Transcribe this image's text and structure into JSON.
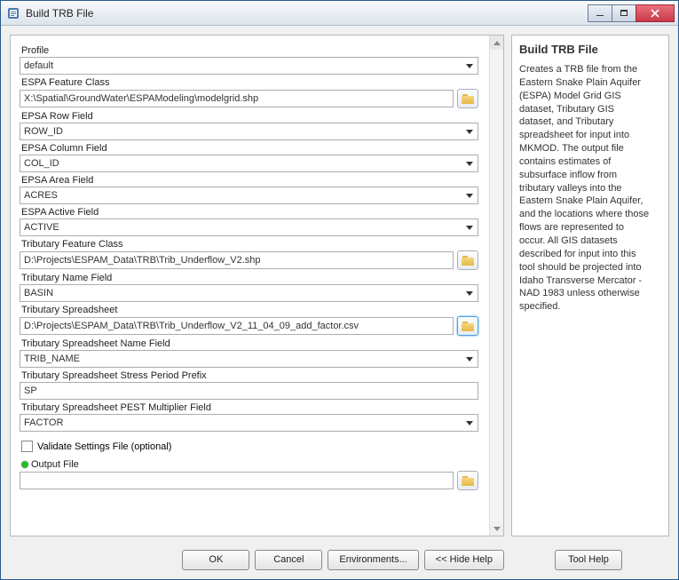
{
  "window": {
    "title": "Build TRB File"
  },
  "fields": {
    "profile": {
      "label": "Profile",
      "value": "default"
    },
    "espaFeature": {
      "label": "ESPA Feature Class",
      "value": "X:\\Spatial\\GroundWater\\ESPAModeling\\modelgrid.shp"
    },
    "espaRow": {
      "label": "EPSA Row Field",
      "value": "ROW_ID"
    },
    "espaCol": {
      "label": "EPSA Column Field",
      "value": "COL_ID"
    },
    "espaArea": {
      "label": "EPSA Area Field",
      "value": "ACRES"
    },
    "espaActive": {
      "label": "ESPA Active Field",
      "value": "ACTIVE"
    },
    "tribFeature": {
      "label": "Tributary Feature Class",
      "value": "D:\\Projects\\ESPAM_Data\\TRB\\Trib_Underflow_V2.shp"
    },
    "tribName": {
      "label": "Tributary Name Field",
      "value": "BASIN"
    },
    "tribSheet": {
      "label": "Tributary Spreadsheet",
      "value": "D:\\Projects\\ESPAM_Data\\TRB\\Trib_Underflow_V2_11_04_09_add_factor.csv"
    },
    "tribSheetName": {
      "label": "Tributary Spreadsheet Name Field",
      "value": "TRIB_NAME"
    },
    "tribSheetSP": {
      "label": "Tributary Spreadsheet Stress Period Prefix",
      "value": "SP"
    },
    "tribSheetPEST": {
      "label": "Tributary Spreadsheet PEST Multiplier Field",
      "value": "FACTOR"
    },
    "validate": {
      "label": "Validate Settings File (optional)"
    },
    "output": {
      "label": "Output File",
      "value": ""
    }
  },
  "buttons": {
    "ok": "OK",
    "cancel": "Cancel",
    "environments": "Environments...",
    "hideHelp": "<< Hide Help",
    "toolHelp": "Tool Help"
  },
  "help": {
    "title": "Build TRB File",
    "body": "Creates a TRB file from the Eastern Snake Plain Aquifer (ESPA) Model Grid GIS dataset, Tributary GIS dataset, and Tributary spreadsheet for input into MKMOD. The output file contains estimates of subsurface inflow from tributary valleys into the Eastern Snake Plain Aquifer, and the locations where those flows are represented to occur. All GIS datasets described for input into this tool should be projected into Idaho Transverse Mercator - NAD 1983 unless otherwise specified."
  }
}
